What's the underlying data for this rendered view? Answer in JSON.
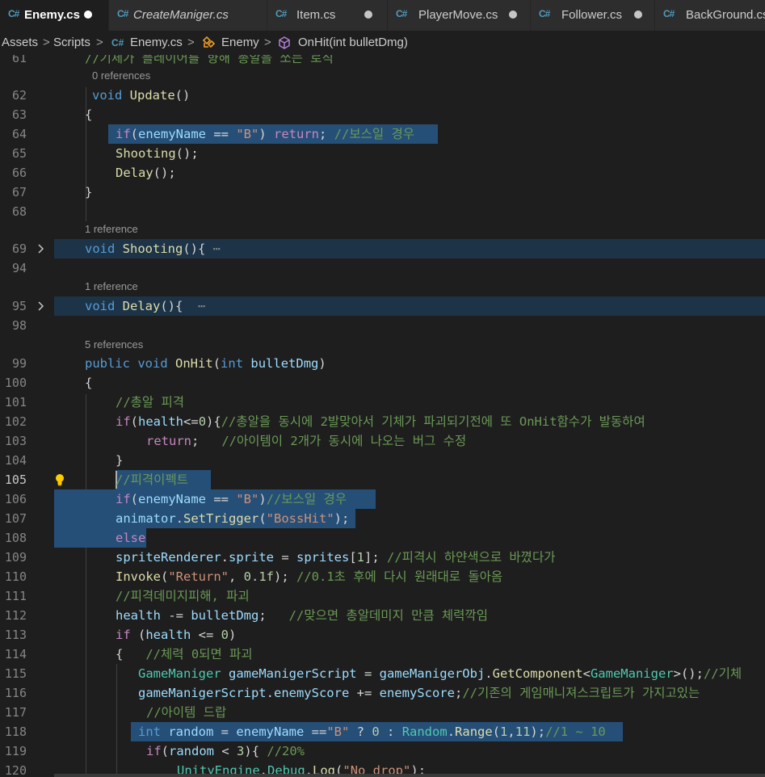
{
  "tabs": [
    {
      "label": "Enemy.cs",
      "active": true,
      "dirty": true,
      "italic": false,
      "icon": "csharp-icon"
    },
    {
      "label": "CreateManiger.cs",
      "active": false,
      "dirty": false,
      "italic": true,
      "icon": "csharp-icon"
    },
    {
      "label": "Item.cs",
      "active": false,
      "dirty": true,
      "italic": false,
      "icon": "csharp-icon"
    },
    {
      "label": "PlayerMove.cs",
      "active": false,
      "dirty": true,
      "italic": false,
      "icon": "csharp-icon"
    },
    {
      "label": "Follower.cs",
      "active": false,
      "dirty": true,
      "italic": false,
      "icon": "csharp-icon"
    },
    {
      "label": "BackGround.cs",
      "active": false,
      "dirty": false,
      "italic": false,
      "icon": "csharp-icon"
    }
  ],
  "tab_icon_glyph": "C#",
  "breadcrumb": {
    "assets": "Assets",
    "scripts": "Scripts",
    "file": "Enemy.cs",
    "class": "Enemy",
    "method": "OnHit(int bulletDmg)",
    "separator": ">"
  },
  "code_lens": {
    "line62": "0 references",
    "line69": "1 reference",
    "line95": "1 reference",
    "line99": "5 references"
  },
  "lines": {
    "l61": {
      "num": "61",
      "comment": "//기체가 플레이어를 향해 총알을 쏘는 로직"
    },
    "l62": {
      "num": "62",
      "t1": "void",
      "t2": "Update",
      "t3": "()"
    },
    "l63": {
      "num": "63",
      "t1": "{"
    },
    "l64": {
      "num": "64",
      "t1": "if",
      "t2": "(",
      "t3": "enemyName",
      "t4": " == ",
      "t5": "\"B\"",
      "t6": ") ",
      "t7": "return",
      "t8": "; ",
      "t9": "//보스일 경우"
    },
    "l65": {
      "num": "65",
      "t1": "Shooting",
      "t2": "();"
    },
    "l66": {
      "num": "66",
      "t1": "Delay",
      "t2": "();"
    },
    "l67": {
      "num": "67",
      "t1": "}"
    },
    "l68": {
      "num": "68"
    },
    "l69": {
      "num": "69",
      "t1": "void",
      "t2": "Shooting",
      "t3": "(){",
      "t4": " ⋯"
    },
    "l94": {
      "num": "94"
    },
    "l95": {
      "num": "95",
      "t1": "void",
      "t2": "Delay",
      "t3": "(){",
      "t4": "  ⋯"
    },
    "l98": {
      "num": "98"
    },
    "l99": {
      "num": "99",
      "t1": "public",
      "t2": "void",
      "t3": "OnHit",
      "t4": "(",
      "t5": "int",
      "t6": "bulletDmg",
      "t7": ")"
    },
    "l100": {
      "num": "100",
      "t1": "{"
    },
    "l101": {
      "num": "101",
      "t1": "//총알 피격"
    },
    "l102": {
      "num": "102",
      "t1": "if",
      "t2": "(",
      "t3": "health",
      "t4": "<=",
      "t5": "0",
      "t6": "){",
      "t7": "//총알을 동시에 2발맞아서 기체가 파괴되기전에 또 OnHit함수가 발동하여"
    },
    "l103": {
      "num": "103",
      "t1": "return",
      "t2": ";",
      "t3": "   //아이템이 2개가 동시에 나오는 버그 수정"
    },
    "l104": {
      "num": "104",
      "t1": "}"
    },
    "l105": {
      "num": "105",
      "t1": "//피격이펙트"
    },
    "l106": {
      "num": "106",
      "t1": "if",
      "t2": "(",
      "t3": "enemyName",
      "t4": " == ",
      "t5": "\"B\"",
      "t6": ")",
      "t7": "//보스일 경우"
    },
    "l107": {
      "num": "107",
      "t1": "animator",
      "t2": ".",
      "t3": "SetTrigger",
      "t4": "(",
      "t5": "\"BossHit\"",
      "t6": ");"
    },
    "l108": {
      "num": "108",
      "t1": "else"
    },
    "l109": {
      "num": "109",
      "t1": "spriteRenderer",
      "t2": ".",
      "t3": "sprite",
      "t4": " = ",
      "t5": "sprites",
      "t6": "[",
      "t7": "1",
      "t8": "]; ",
      "t9": "//피격시 하얀색으로 바꼈다가"
    },
    "l110": {
      "num": "110",
      "t1": "Invoke",
      "t2": "(",
      "t3": "\"Return\"",
      "t4": ", ",
      "t5": "0.1f",
      "t6": "); ",
      "t7": "//0.1초 후에 다시 원래대로 돌아옴"
    },
    "l111": {
      "num": "111",
      "t1": "//피격데미지피해, 파괴"
    },
    "l112": {
      "num": "112",
      "t1": "health",
      "t2": " -= ",
      "t3": "bulletDmg",
      "t4": ";   ",
      "t5": "//맞으면 총알데미지 만큼 체력깍임"
    },
    "l113": {
      "num": "113",
      "t1": "if",
      "t2": " (",
      "t3": "health",
      "t4": " <= ",
      "t5": "0",
      "t6": ")"
    },
    "l114": {
      "num": "114",
      "t1": "{",
      "t2": "   //체력 0되면 파괴"
    },
    "l115": {
      "num": "115",
      "t1": "GameManiger",
      "t2": "gameManigerScript",
      "t3": " = ",
      "t4": "gameManigerObj",
      "t5": ".",
      "t6": "GetComponent",
      "t7": "<",
      "t8": "GameManiger",
      "t9": ">();",
      "t10": "//기체"
    },
    "l116": {
      "num": "116",
      "t1": "gameManigerScript",
      "t2": ".",
      "t3": "enemyScore",
      "t4": " += ",
      "t5": "enemyScore",
      "t6": ";",
      "t7": "//기존의 게임매니져스크립트가 가지고있는"
    },
    "l117": {
      "num": "117",
      "t1": "//아이템 드랍"
    },
    "l118": {
      "num": "118",
      "t1": "int",
      "t2": "random",
      "t3": " = ",
      "t4": "enemyName",
      "t5": " ==",
      "t6": "\"B\"",
      "t7": " ? ",
      "t8": "0",
      "t9": " : ",
      "t10": "Random",
      "t11": ".",
      "t12": "Range",
      "t13": "(",
      "t14": "1",
      "t15": ",",
      "t16": "11",
      "t17": ");",
      "t18": "//1 ~ 10"
    },
    "l119": {
      "num": "119",
      "t1": "if",
      "t2": "(",
      "t3": "random",
      "t4": " < ",
      "t5": "3",
      "t6": "){ ",
      "t7": "//20%"
    },
    "l120": {
      "num": "120",
      "t1": "UnityEngine",
      "t2": ".",
      "t3": "Debug",
      "t4": ".",
      "t5": "Log",
      "t6": "(",
      "t7": "\"No drop\"",
      "t8": ");"
    }
  }
}
